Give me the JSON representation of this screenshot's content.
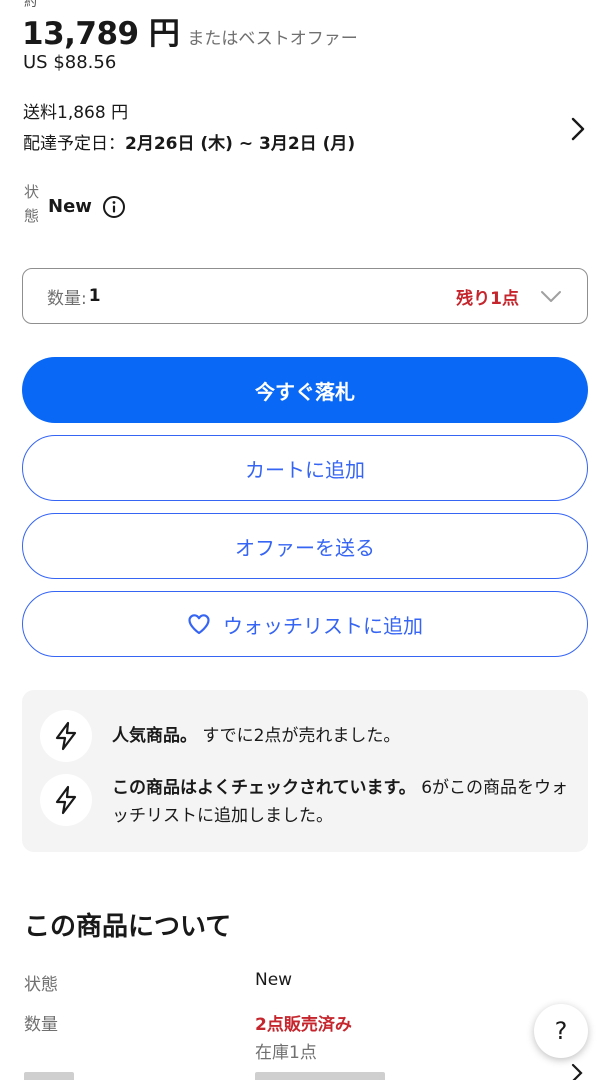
{
  "header": {
    "price_prefix": "約",
    "price": "13,789 円",
    "offer_text": "またはベストオファー",
    "usd_price": "US $88.56"
  },
  "shipping": {
    "fee": "送料1,868 円",
    "delivery_label": "配達予定日：",
    "delivery_dates": "2月26日 (木) ~ 3月2日 (月)"
  },
  "condition": {
    "label": "状態",
    "value": "New"
  },
  "quantity": {
    "label": "数量:",
    "value": "1",
    "remaining": "残り1点"
  },
  "buttons": {
    "buy_now": "今すぐ落札",
    "add_to_cart": "カートに追加",
    "make_offer": "オファーを送る",
    "add_to_watchlist": "ウォッチリストに追加"
  },
  "signals": [
    {
      "title": "人気商品。",
      "text": "すでに2点が売れました。"
    },
    {
      "title": "この商品はよくチェックされています。",
      "text": "6がこの商品をウォッチリストに追加しました。"
    }
  ],
  "about": {
    "title": "この商品について",
    "specs": [
      {
        "label": "状態",
        "value": "New"
      },
      {
        "label": "数量",
        "value": "2点販売済み",
        "sub": "在庫1点"
      }
    ]
  },
  "help": {
    "label": "?"
  },
  "colors": {
    "primary": "#0968f6",
    "link_blue": "#3665f3",
    "alert_red": "#c5262d",
    "panel_gray": "#f4f4f4"
  }
}
